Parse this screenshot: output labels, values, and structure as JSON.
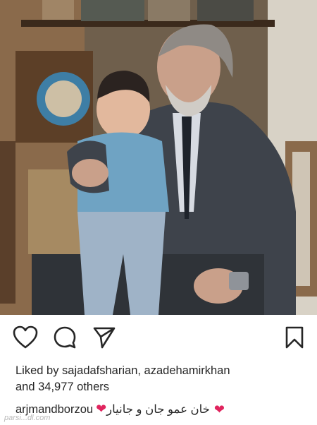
{
  "post": {
    "liked_by_prefix": "Liked by ",
    "liked_by_users": "sajadafsharian, azadehamirkhan",
    "others": "and 34,977 others",
    "caption_user": "arjmandborzou",
    "caption_text": "خان عمو جان و جانیار",
    "heart_1": "❤",
    "heart_2": "❤",
    "watermark": "parsi...dl.com"
  },
  "icons": {
    "like": "heart-outline-icon",
    "comment": "comment-bubble-icon",
    "share": "paper-plane-icon",
    "save": "bookmark-icon"
  }
}
